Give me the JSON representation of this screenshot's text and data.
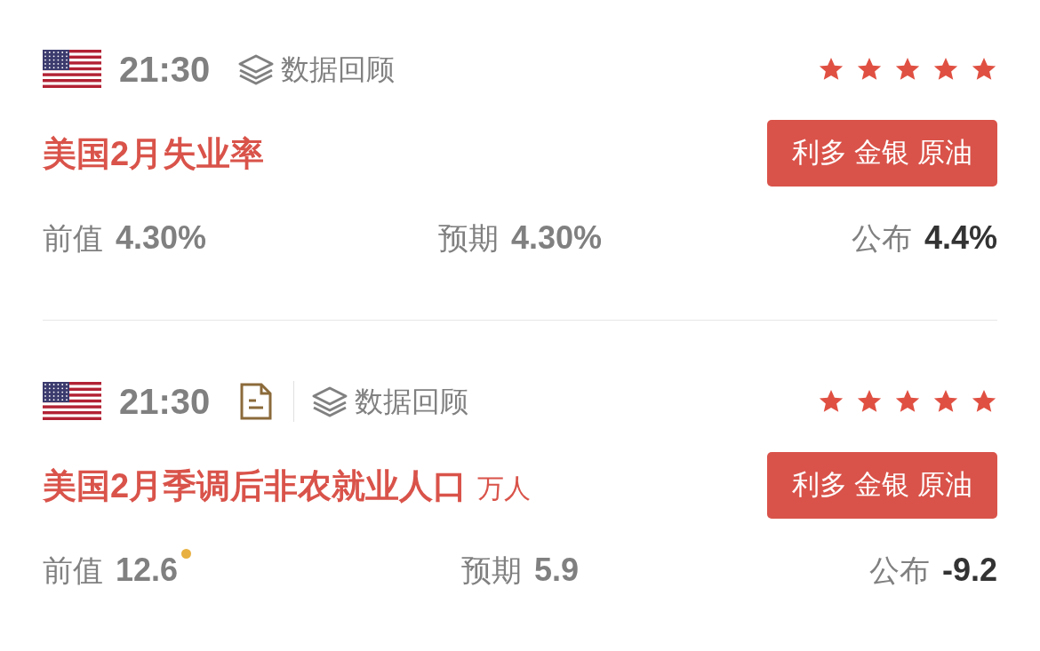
{
  "events": [
    {
      "time": "21:30",
      "has_document": false,
      "review_label": "数据回顾",
      "stars": 5,
      "title": "美国2月失业率",
      "tag": "利多 金银 原油",
      "previous_label": "前值",
      "previous": "4.30%",
      "previous_revised": false,
      "forecast_label": "预期",
      "forecast": "4.30%",
      "actual_label": "公布",
      "actual": "4.4%"
    },
    {
      "time": "21:30",
      "has_document": true,
      "review_label": "数据回顾",
      "stars": 5,
      "title": "美国2月季调后非农就业人口",
      "unit": "万人",
      "tag": "利多 金银 原油",
      "previous_label": "前值",
      "previous": "12.6",
      "previous_revised": true,
      "forecast_label": "预期",
      "forecast": "5.9",
      "actual_label": "公布",
      "actual": "-9.2"
    }
  ]
}
